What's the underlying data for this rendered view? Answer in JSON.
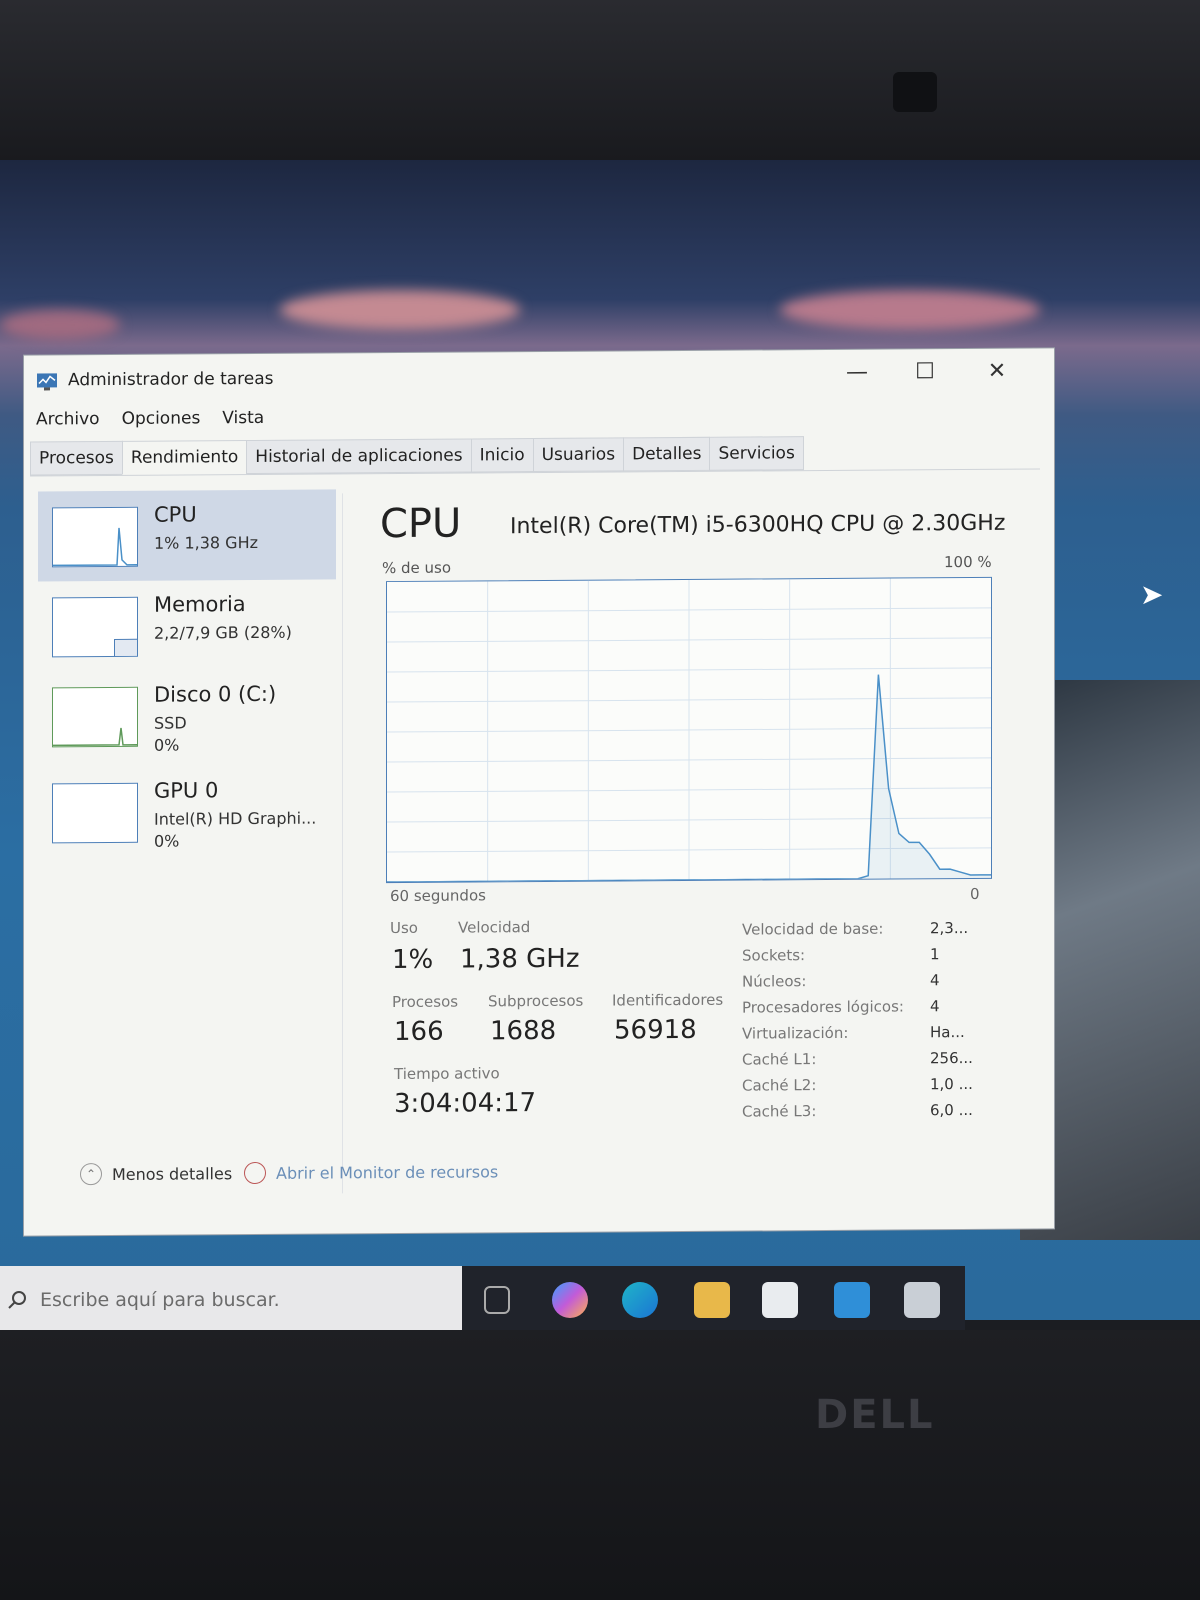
{
  "window": {
    "title": "Administrador de tareas",
    "controls": {
      "minimize": "—",
      "maximize": "☐",
      "close": "✕"
    }
  },
  "menu": [
    "Archivo",
    "Opciones",
    "Vista"
  ],
  "tabs": [
    "Procesos",
    "Rendimiento",
    "Historial de aplicaciones",
    "Inicio",
    "Usuarios",
    "Detalles",
    "Servicios"
  ],
  "active_tab": "Rendimiento",
  "sidebar": {
    "cpu": {
      "title": "CPU",
      "sub": "1% 1,38 GHz"
    },
    "memory": {
      "title": "Memoria",
      "sub": "2,2/7,9 GB (28%)"
    },
    "disk": {
      "title": "Disco 0 (C:)",
      "sub1": "SSD",
      "sub2": "0%"
    },
    "gpu": {
      "title": "GPU 0",
      "sub1": "Intel(R) HD Graphi...",
      "sub2": "0%"
    }
  },
  "main": {
    "heading": "CPU",
    "model": "Intel(R) Core(TM) i5-6300HQ CPU @ 2.30GHz",
    "graph_label": "% de uso",
    "graph_max": "100 %",
    "graph_span": "60 segundos",
    "graph_min": "0",
    "usage_series": [
      0,
      0,
      0,
      0,
      0,
      0,
      0,
      0,
      0,
      0,
      0,
      0,
      0,
      0,
      0,
      0,
      0,
      0,
      0,
      0,
      0,
      0,
      0,
      0,
      0,
      0,
      0,
      0,
      0,
      0,
      0,
      0,
      0,
      0,
      0,
      0,
      0,
      0,
      0,
      0,
      0,
      0,
      0,
      0,
      0,
      0,
      0,
      1,
      68,
      30,
      15,
      12,
      12,
      8,
      3,
      3,
      2,
      1,
      1,
      1
    ],
    "stats": {
      "uso_label": "Uso",
      "uso": "1%",
      "velocidad_label": "Velocidad",
      "velocidad": "1,38 GHz",
      "procesos_label": "Procesos",
      "procesos": "166",
      "subprocesos_label": "Subprocesos",
      "subprocesos": "1688",
      "identificadores_label": "Identificadores",
      "identificadores": "56918",
      "tiempo_label": "Tiempo activo",
      "tiempo": "3:04:04:17"
    },
    "specs": [
      {
        "label": "Velocidad de base:",
        "value": "2,3..."
      },
      {
        "label": "Sockets:",
        "value": "1"
      },
      {
        "label": "Núcleos:",
        "value": "4"
      },
      {
        "label": "Procesadores lógicos:",
        "value": "4"
      },
      {
        "label": "Virtualización:",
        "value": "Ha..."
      },
      {
        "label": "Caché L1:",
        "value": "256..."
      },
      {
        "label": "Caché L2:",
        "value": "1,0 ..."
      },
      {
        "label": "Caché L3:",
        "value": "6,0 ..."
      }
    ]
  },
  "footer": {
    "less_details": "Menos detalles",
    "resource_monitor": "Abrir el Monitor de recursos"
  },
  "taskbar": {
    "search_placeholder": "Escribe aquí para buscar."
  },
  "brand": "DELL",
  "colors": {
    "graph_line": "#4a90c8",
    "selection": "#cfd8e6"
  }
}
